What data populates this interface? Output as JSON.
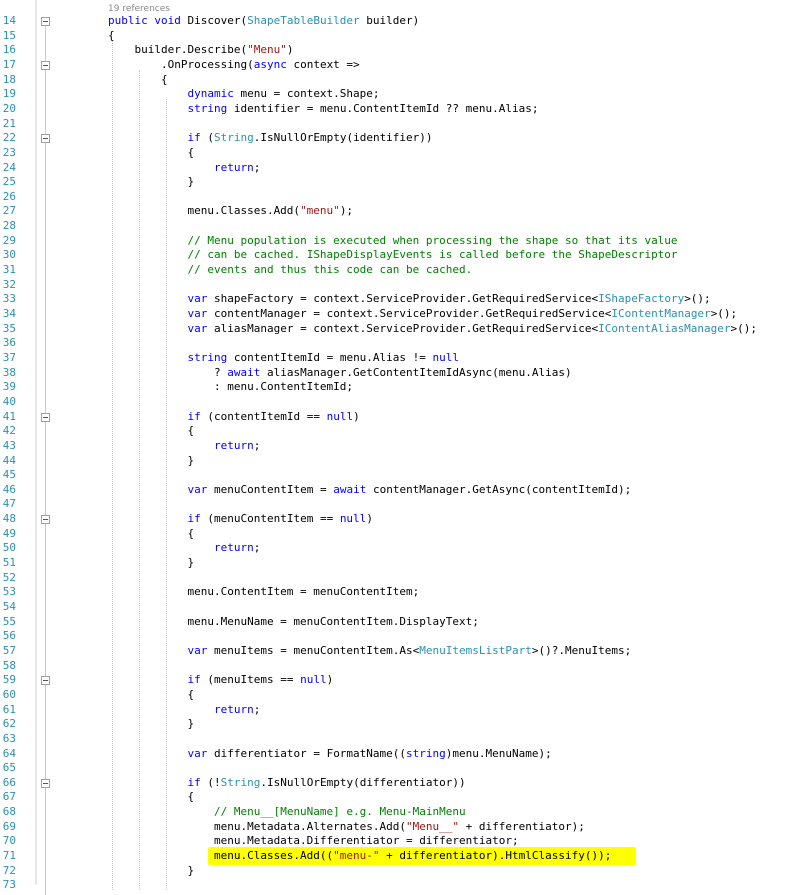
{
  "editor": {
    "reference_note": "19 references",
    "lines": [
      {
        "n": "14",
        "fold": true,
        "tokens": [
          {
            "t": "public void ",
            "c": "keyword"
          },
          {
            "t": "Discover(",
            "c": "plain"
          },
          {
            "t": "ShapeTableBuilder",
            "c": "type"
          },
          {
            "t": " builder)",
            "c": "plain"
          }
        ]
      },
      {
        "n": "15",
        "tokens": [
          {
            "t": "{",
            "c": "plain"
          }
        ]
      },
      {
        "n": "16",
        "tokens": [
          {
            "t": "    builder.Describe(",
            "c": "plain"
          },
          {
            "t": "\"Menu\"",
            "c": "string"
          },
          {
            "t": ")",
            "c": "plain"
          }
        ]
      },
      {
        "n": "17",
        "fold": true,
        "tokens": [
          {
            "t": "        .OnProcessing(",
            "c": "plain"
          },
          {
            "t": "async",
            "c": "keyword"
          },
          {
            "t": " context =>",
            "c": "plain"
          }
        ]
      },
      {
        "n": "18",
        "tokens": [
          {
            "t": "        {",
            "c": "plain"
          }
        ]
      },
      {
        "n": "19",
        "tokens": [
          {
            "t": "            ",
            "c": "plain"
          },
          {
            "t": "dynamic",
            "c": "keyword"
          },
          {
            "t": " menu = context.Shape;",
            "c": "plain"
          }
        ]
      },
      {
        "n": "20",
        "tokens": [
          {
            "t": "            ",
            "c": "plain"
          },
          {
            "t": "string",
            "c": "keyword"
          },
          {
            "t": " identifier = menu.ContentItemId ?? menu.Alias;",
            "c": "plain"
          }
        ]
      },
      {
        "n": "21",
        "tokens": []
      },
      {
        "n": "22",
        "fold": true,
        "tokens": [
          {
            "t": "            ",
            "c": "plain"
          },
          {
            "t": "if",
            "c": "keyword"
          },
          {
            "t": " (",
            "c": "plain"
          },
          {
            "t": "String",
            "c": "type"
          },
          {
            "t": ".IsNullOrEmpty(identifier))",
            "c": "plain"
          }
        ]
      },
      {
        "n": "23",
        "tokens": [
          {
            "t": "            {",
            "c": "plain"
          }
        ]
      },
      {
        "n": "24",
        "tokens": [
          {
            "t": "                ",
            "c": "plain"
          },
          {
            "t": "return",
            "c": "keyword"
          },
          {
            "t": ";",
            "c": "plain"
          }
        ]
      },
      {
        "n": "25",
        "tokens": [
          {
            "t": "            }",
            "c": "plain"
          }
        ]
      },
      {
        "n": "26",
        "tokens": []
      },
      {
        "n": "27",
        "tokens": [
          {
            "t": "            menu.Classes.Add(",
            "c": "plain"
          },
          {
            "t": "\"menu\"",
            "c": "string"
          },
          {
            "t": ");",
            "c": "plain"
          }
        ]
      },
      {
        "n": "28",
        "tokens": []
      },
      {
        "n": "29",
        "tokens": [
          {
            "t": "            ",
            "c": "plain"
          },
          {
            "t": "// Menu population is executed when processing the shape so that its value",
            "c": "comment"
          }
        ]
      },
      {
        "n": "30",
        "tokens": [
          {
            "t": "            ",
            "c": "plain"
          },
          {
            "t": "// can be cached. IShapeDisplayEvents is called before the ShapeDescriptor",
            "c": "comment"
          }
        ]
      },
      {
        "n": "31",
        "tokens": [
          {
            "t": "            ",
            "c": "plain"
          },
          {
            "t": "// events and thus this code can be cached.",
            "c": "comment"
          }
        ]
      },
      {
        "n": "32",
        "tokens": []
      },
      {
        "n": "33",
        "tokens": [
          {
            "t": "            ",
            "c": "plain"
          },
          {
            "t": "var",
            "c": "keyword"
          },
          {
            "t": " shapeFactory = context.ServiceProvider.GetRequiredService<",
            "c": "plain"
          },
          {
            "t": "IShapeFactory",
            "c": "type"
          },
          {
            "t": ">();",
            "c": "plain"
          }
        ]
      },
      {
        "n": "34",
        "tokens": [
          {
            "t": "            ",
            "c": "plain"
          },
          {
            "t": "var",
            "c": "keyword"
          },
          {
            "t": " contentManager = context.ServiceProvider.GetRequiredService<",
            "c": "plain"
          },
          {
            "t": "IContentManager",
            "c": "type"
          },
          {
            "t": ">();",
            "c": "plain"
          }
        ]
      },
      {
        "n": "35",
        "tokens": [
          {
            "t": "            ",
            "c": "plain"
          },
          {
            "t": "var",
            "c": "keyword"
          },
          {
            "t": " aliasManager = context.ServiceProvider.GetRequiredService<",
            "c": "plain"
          },
          {
            "t": "IContentAliasManager",
            "c": "type"
          },
          {
            "t": ">();",
            "c": "plain"
          }
        ]
      },
      {
        "n": "36",
        "tokens": []
      },
      {
        "n": "37",
        "tokens": [
          {
            "t": "            ",
            "c": "plain"
          },
          {
            "t": "string",
            "c": "keyword"
          },
          {
            "t": " contentItemId = menu.Alias != ",
            "c": "plain"
          },
          {
            "t": "null",
            "c": "keyword"
          }
        ]
      },
      {
        "n": "38",
        "tokens": [
          {
            "t": "                ? ",
            "c": "plain"
          },
          {
            "t": "await",
            "c": "keyword"
          },
          {
            "t": " aliasManager.GetContentItemIdAsync(menu.Alias)",
            "c": "plain"
          }
        ]
      },
      {
        "n": "39",
        "tokens": [
          {
            "t": "                : menu.ContentItemId;",
            "c": "plain"
          }
        ]
      },
      {
        "n": "40",
        "tokens": []
      },
      {
        "n": "41",
        "fold": true,
        "tokens": [
          {
            "t": "            ",
            "c": "plain"
          },
          {
            "t": "if",
            "c": "keyword"
          },
          {
            "t": " (contentItemId == ",
            "c": "plain"
          },
          {
            "t": "null",
            "c": "keyword"
          },
          {
            "t": ")",
            "c": "plain"
          }
        ]
      },
      {
        "n": "42",
        "tokens": [
          {
            "t": "            {",
            "c": "plain"
          }
        ]
      },
      {
        "n": "43",
        "tokens": [
          {
            "t": "                ",
            "c": "plain"
          },
          {
            "t": "return",
            "c": "keyword"
          },
          {
            "t": ";",
            "c": "plain"
          }
        ]
      },
      {
        "n": "44",
        "tokens": [
          {
            "t": "            }",
            "c": "plain"
          }
        ]
      },
      {
        "n": "45",
        "tokens": []
      },
      {
        "n": "46",
        "tokens": [
          {
            "t": "            ",
            "c": "plain"
          },
          {
            "t": "var",
            "c": "keyword"
          },
          {
            "t": " menuContentItem = ",
            "c": "plain"
          },
          {
            "t": "await",
            "c": "keyword"
          },
          {
            "t": " contentManager.GetAsync(contentItemId);",
            "c": "plain"
          }
        ]
      },
      {
        "n": "47",
        "tokens": []
      },
      {
        "n": "48",
        "fold": true,
        "tokens": [
          {
            "t": "            ",
            "c": "plain"
          },
          {
            "t": "if",
            "c": "keyword"
          },
          {
            "t": " (menuContentItem == ",
            "c": "plain"
          },
          {
            "t": "null",
            "c": "keyword"
          },
          {
            "t": ")",
            "c": "plain"
          }
        ]
      },
      {
        "n": "49",
        "tokens": [
          {
            "t": "            {",
            "c": "plain"
          }
        ]
      },
      {
        "n": "50",
        "tokens": [
          {
            "t": "                ",
            "c": "plain"
          },
          {
            "t": "return",
            "c": "keyword"
          },
          {
            "t": ";",
            "c": "plain"
          }
        ]
      },
      {
        "n": "51",
        "tokens": [
          {
            "t": "            }",
            "c": "plain"
          }
        ]
      },
      {
        "n": "52",
        "tokens": []
      },
      {
        "n": "53",
        "tokens": [
          {
            "t": "            menu.ContentItem = menuContentItem;",
            "c": "plain"
          }
        ]
      },
      {
        "n": "54",
        "tokens": []
      },
      {
        "n": "55",
        "tokens": [
          {
            "t": "            menu.MenuName = menuContentItem.DisplayText;",
            "c": "plain"
          }
        ]
      },
      {
        "n": "56",
        "tokens": []
      },
      {
        "n": "57",
        "tokens": [
          {
            "t": "            ",
            "c": "plain"
          },
          {
            "t": "var",
            "c": "keyword"
          },
          {
            "t": " menuItems = menuContentItem.As<",
            "c": "plain"
          },
          {
            "t": "MenuItemsListPart",
            "c": "type"
          },
          {
            "t": ">()?.MenuItems;",
            "c": "plain"
          }
        ]
      },
      {
        "n": "58",
        "tokens": []
      },
      {
        "n": "59",
        "fold": true,
        "tokens": [
          {
            "t": "            ",
            "c": "plain"
          },
          {
            "t": "if",
            "c": "keyword"
          },
          {
            "t": " (menuItems == ",
            "c": "plain"
          },
          {
            "t": "null",
            "c": "keyword"
          },
          {
            "t": ")",
            "c": "plain"
          }
        ]
      },
      {
        "n": "60",
        "tokens": [
          {
            "t": "            {",
            "c": "plain"
          }
        ]
      },
      {
        "n": "61",
        "tokens": [
          {
            "t": "                ",
            "c": "plain"
          },
          {
            "t": "return",
            "c": "keyword"
          },
          {
            "t": ";",
            "c": "plain"
          }
        ]
      },
      {
        "n": "62",
        "tokens": [
          {
            "t": "            }",
            "c": "plain"
          }
        ]
      },
      {
        "n": "63",
        "tokens": []
      },
      {
        "n": "64",
        "tokens": [
          {
            "t": "            ",
            "c": "plain"
          },
          {
            "t": "var",
            "c": "keyword"
          },
          {
            "t": " differentiator = FormatName((",
            "c": "plain"
          },
          {
            "t": "string",
            "c": "keyword"
          },
          {
            "t": ")menu.MenuName);",
            "c": "plain"
          }
        ]
      },
      {
        "n": "65",
        "tokens": []
      },
      {
        "n": "66",
        "fold": true,
        "tokens": [
          {
            "t": "            ",
            "c": "plain"
          },
          {
            "t": "if",
            "c": "keyword"
          },
          {
            "t": " (!",
            "c": "plain"
          },
          {
            "t": "String",
            "c": "type"
          },
          {
            "t": ".IsNullOrEmpty(differentiator))",
            "c": "plain"
          }
        ]
      },
      {
        "n": "67",
        "tokens": [
          {
            "t": "            {",
            "c": "plain"
          }
        ]
      },
      {
        "n": "68",
        "tokens": [
          {
            "t": "                ",
            "c": "plain"
          },
          {
            "t": "// Menu__[MenuName] e.g. Menu-MainMenu",
            "c": "comment"
          }
        ]
      },
      {
        "n": "69",
        "tokens": [
          {
            "t": "                menu.Metadata.Alternates.Add(",
            "c": "plain"
          },
          {
            "t": "\"Menu__\"",
            "c": "string"
          },
          {
            "t": " + differentiator);",
            "c": "plain"
          }
        ]
      },
      {
        "n": "70",
        "tokens": [
          {
            "t": "                menu.Metadata.Differentiator = differentiator;",
            "c": "plain"
          }
        ]
      },
      {
        "n": "71",
        "highlight": true,
        "tokens": [
          {
            "t": "                menu.Classes.Add((",
            "c": "plain"
          },
          {
            "t": "\"menu-\"",
            "c": "string"
          },
          {
            "t": " + differentiator).HtmlClassify());",
            "c": "plain"
          }
        ]
      },
      {
        "n": "72",
        "tokens": [
          {
            "t": "            }",
            "c": "plain"
          }
        ]
      },
      {
        "n": "73",
        "tokens": []
      }
    ]
  }
}
